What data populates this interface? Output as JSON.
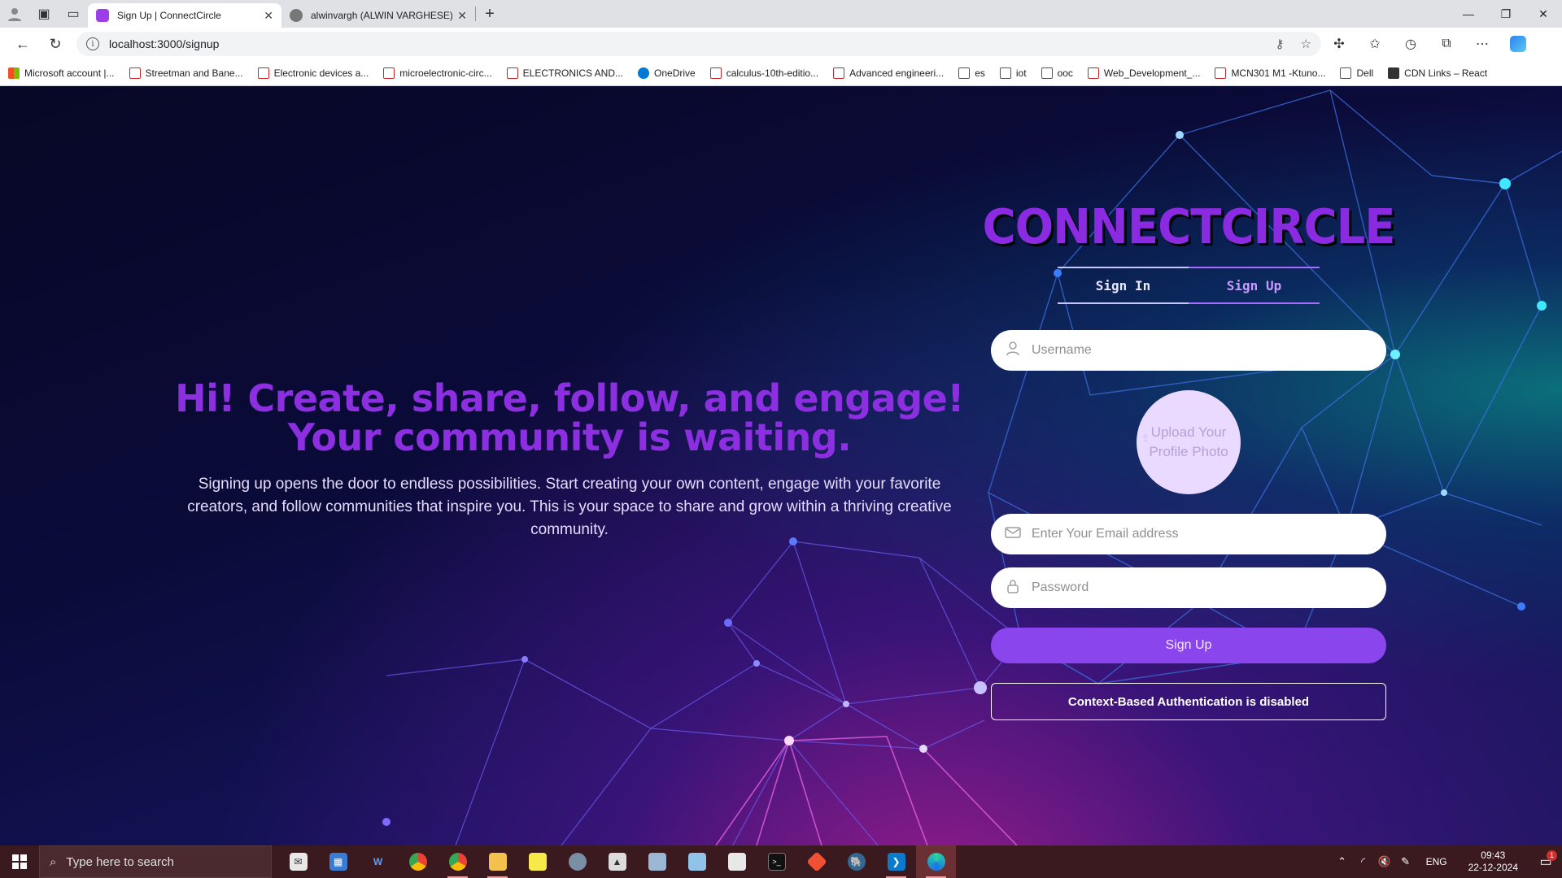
{
  "browser": {
    "tabs": [
      {
        "title": "Sign Up | ConnectCircle",
        "active": true
      },
      {
        "title": "alwinvargh (ALWIN VARGHESE)",
        "active": false
      }
    ],
    "url": "localhost:3000/signup",
    "bookmarks": [
      {
        "label": "Microsoft account |...",
        "icon": "ms"
      },
      {
        "label": "Streetman and Bane...",
        "icon": "pdf"
      },
      {
        "label": "Electronic devices a...",
        "icon": "pdf"
      },
      {
        "label": "microelectronic-circ...",
        "icon": "pdf"
      },
      {
        "label": "ELECTRONICS AND...",
        "icon": "pdf"
      },
      {
        "label": "OneDrive",
        "icon": "cloud"
      },
      {
        "label": "calculus-10th-editio...",
        "icon": "pdf"
      },
      {
        "label": "Advanced engineeri...",
        "icon": "pdf"
      },
      {
        "label": "es",
        "icon": "folder"
      },
      {
        "label": "iot",
        "icon": "folder"
      },
      {
        "label": "ooc",
        "icon": "folder"
      },
      {
        "label": "Web_Development_...",
        "icon": "pdf"
      },
      {
        "label": "MCN301 M1 -Ktuno...",
        "icon": "pdf"
      },
      {
        "label": "Dell",
        "icon": "folder"
      },
      {
        "label": "CDN Links – React",
        "icon": "cdn"
      }
    ]
  },
  "hero": {
    "headline": "Hi! Create, share, follow, and engage! Your community is waiting.",
    "description": "Signing up opens the door to endless possibilities. Start creating your own content, engage with your favorite creators, and follow communities that inspire you. This is your space to share and grow within a thriving creative community."
  },
  "auth": {
    "logo_text": "CONNECTCIRCLE",
    "tab_signin": "Sign In",
    "tab_signup": "Sign Up",
    "username_placeholder": "Username",
    "upload_label": "Upload Your Profile Photo",
    "email_placeholder": "Enter Your Email address",
    "password_placeholder": "Password",
    "submit_label": "Sign Up",
    "context_notice": "Context-Based Authentication is disabled"
  },
  "taskbar": {
    "search_placeholder": "Type here to search",
    "language": "ENG",
    "time": "09:43",
    "date": "22-12-2024",
    "notification_count": "1"
  },
  "colors": {
    "accent": "#8b45ec",
    "headline": "#8b2fe0",
    "tab_active": "#c79bff"
  }
}
